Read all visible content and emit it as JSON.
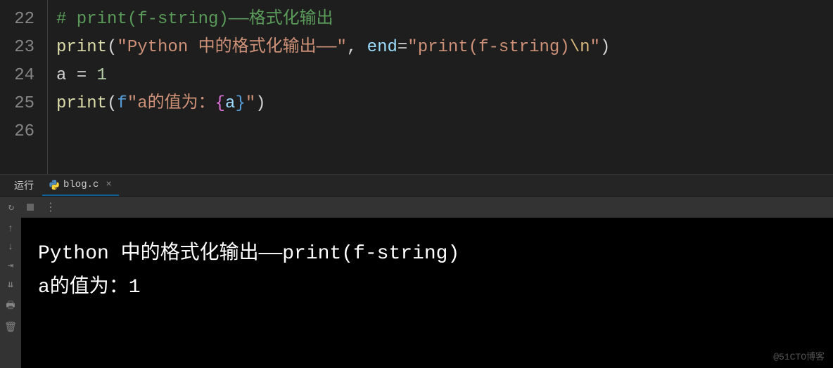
{
  "editor": {
    "lines": [
      {
        "num": "22"
      },
      {
        "num": "23"
      },
      {
        "num": "24"
      },
      {
        "num": "25"
      },
      {
        "num": "26"
      }
    ],
    "code": {
      "line22": {
        "comment": "# print(f-string)——格式化输出"
      },
      "line23": {
        "func": "print",
        "str1": "\"Python 中的格式化输出——\"",
        "sep": ", ",
        "kwarg": "end",
        "eq": "=",
        "str2a": "\"print(f-string)",
        "esc": "\\n",
        "str2b": "\""
      },
      "line24": {
        "var": "a ",
        "eq": "= ",
        "num": "1"
      },
      "line25": {
        "func": "print",
        "fprefix": "f",
        "str1": "\"a的值为：",
        "brace_open": "{",
        "brace_var": "a",
        "brace_close": "}",
        "str2": "\""
      }
    }
  },
  "panel": {
    "run_label": "运行",
    "file_label": "blog.c",
    "close": "×"
  },
  "toolbar": {
    "rerun": "↻",
    "dots": "⋮"
  },
  "sidebar_icons": {
    "up": "↑",
    "down": "↓",
    "wrap": "⇥",
    "scroll": "⇊",
    "print": "🖶",
    "trash": "🗑"
  },
  "output": {
    "line1": "Python 中的格式化输出——print(f-string)",
    "line2": "a的值为：1"
  },
  "watermark": "@51CTO博客"
}
